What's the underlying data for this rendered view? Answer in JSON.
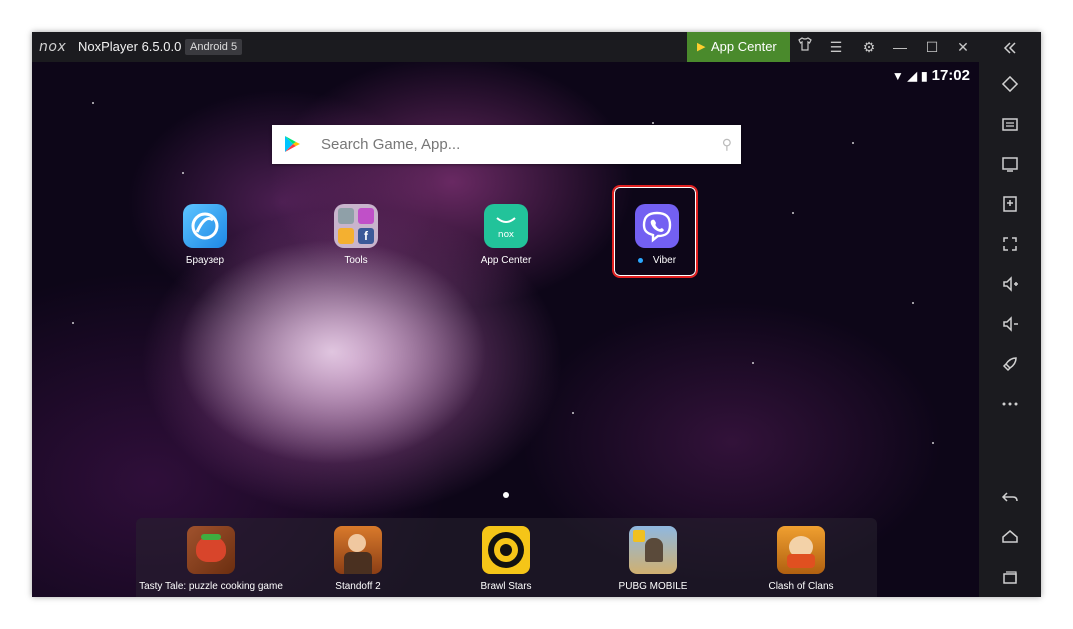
{
  "window": {
    "logo_text": "nox",
    "app_name": "NoxPlayer 6.5.0.0",
    "android_badge": "Android 5",
    "app_center_button": "App Center"
  },
  "status_bar": {
    "time": "17:02"
  },
  "search": {
    "placeholder": "Search Game, App..."
  },
  "home_apps": [
    {
      "label": "Браузер"
    },
    {
      "label": "Tools"
    },
    {
      "label": "App Center"
    },
    {
      "label": "Viber"
    }
  ],
  "dock_apps": [
    {
      "label": "Tasty Tale: puzzle cooking game"
    },
    {
      "label": "Standoff 2"
    },
    {
      "label": "Brawl Stars"
    },
    {
      "label": "PUBG MOBILE"
    },
    {
      "label": "Clash of Clans"
    }
  ],
  "sidebar_icons": [
    "collapse-icon",
    "rotate-icon",
    "keyboard-icon",
    "screen-icon",
    "apk-install-icon",
    "fullscreen-icon",
    "volume-up-icon",
    "volume-down-icon",
    "rocket-icon",
    "more-icon",
    "back-icon",
    "home-icon",
    "recent-apps-icon"
  ],
  "colors": {
    "app_center_green": "#4a8a2c",
    "highlight_red": "#e02020",
    "viber_purple": "#7360f2"
  }
}
